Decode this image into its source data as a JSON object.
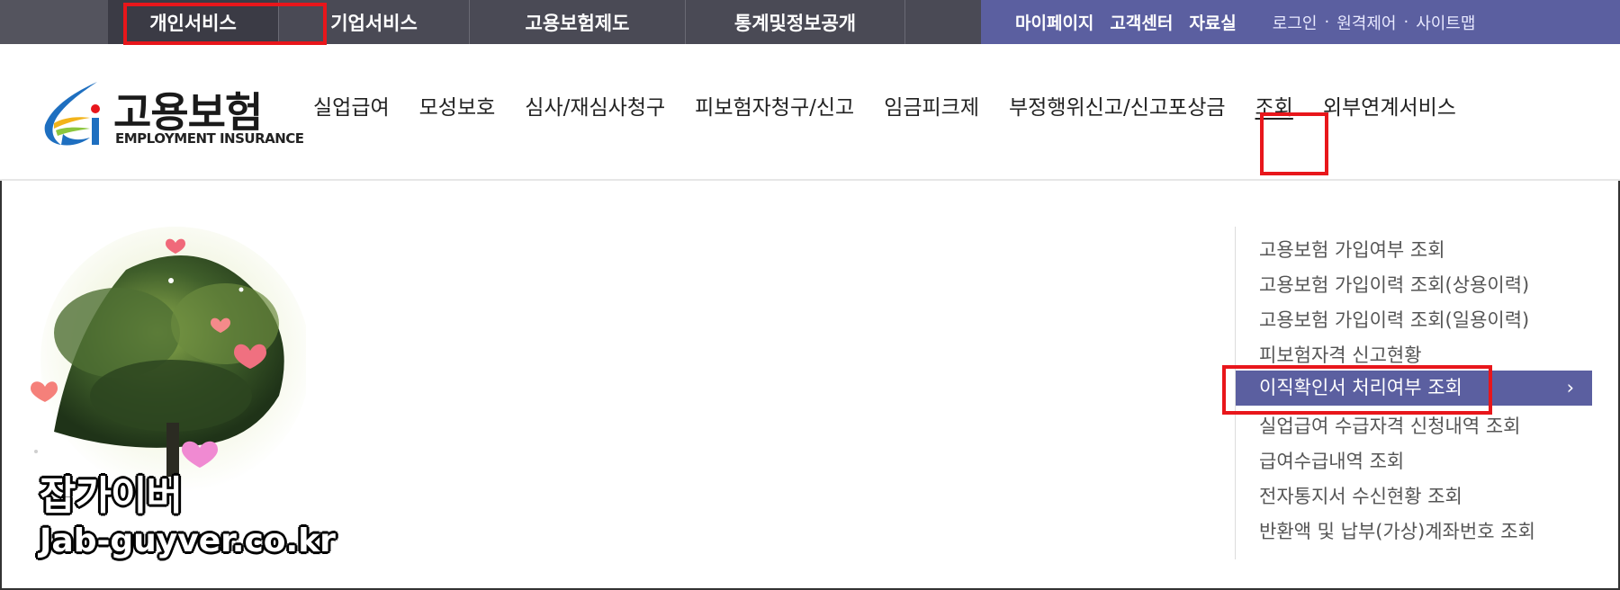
{
  "topbar": {
    "nav": [
      {
        "label": "개인서비스",
        "active": true
      },
      {
        "label": "기업서비스",
        "active": false
      },
      {
        "label": "고용보험제도",
        "active": false
      },
      {
        "label": "통계및정보공개",
        "active": false
      }
    ],
    "util_primary": [
      "마이페이지",
      "고객센터",
      "자료실"
    ],
    "util_secondary": [
      "로그인",
      "원격제어",
      "사이트맵"
    ],
    "colors": {
      "bar": "#4a4a55",
      "util": "#5b5fa0"
    }
  },
  "logo": {
    "name": "고용보험",
    "english": "EMPLOYMENT INSURANCE"
  },
  "main_nav": [
    {
      "label": "실업급여",
      "active": false
    },
    {
      "label": "모성보호",
      "active": false
    },
    {
      "label": "심사/재심사청구",
      "active": false
    },
    {
      "label": "피보험자청구/신고",
      "active": false
    },
    {
      "label": "임금피크제",
      "active": false
    },
    {
      "label": "부정행위신고/신고포상금",
      "active": false
    },
    {
      "label": "조회",
      "active": true
    },
    {
      "label": "외부연계서비스",
      "active": false
    }
  ],
  "submenu": {
    "items": [
      {
        "label": "고용보험 가입여부 조회",
        "active": false
      },
      {
        "label": "고용보험 가입이력 조회(상용이력)",
        "active": false
      },
      {
        "label": "고용보험 가입이력 조회(일용이력)",
        "active": false
      },
      {
        "label": "피보험자격 신고현황",
        "active": false
      },
      {
        "label": "이직확인서 처리여부 조회",
        "active": true
      },
      {
        "label": "실업급여 수급자격 신청내역 조회",
        "active": false
      },
      {
        "label": "급여수급내역 조회",
        "active": false
      },
      {
        "label": "전자통지서 수신현황 조회",
        "active": false
      },
      {
        "label": "반환액 및 납부(가상)계좌번호 조회",
        "active": false
      }
    ],
    "chevron": "›"
  },
  "watermark": {
    "korean": "잡가이버",
    "url": "Jab-guyver.co.kr"
  },
  "highlight_color": "#e8161b"
}
